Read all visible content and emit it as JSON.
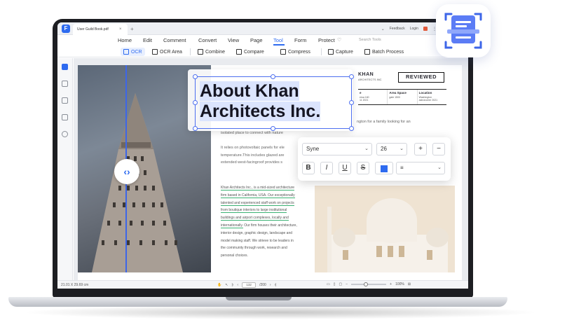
{
  "window": {
    "tab_title": "User Guild Book.pdf",
    "tab_close": "×",
    "tab_add": "+",
    "feedback": "Feedback",
    "login": "Login"
  },
  "menu": {
    "items": [
      "Home",
      "Edit",
      "Comment",
      "Convert",
      "View",
      "Page",
      "Tool",
      "Form",
      "Protect"
    ],
    "active": "Tool",
    "search_placeholder": "Search Tools"
  },
  "toolbar": {
    "tools": [
      "OCR",
      "OCR Area",
      "Combine",
      "Compare",
      "Compress",
      "Capture",
      "Batch Process"
    ],
    "active": "OCR"
  },
  "document": {
    "brand_name": "KHAN",
    "brand_sub": "ARCHITECTS INC",
    "badge": "REVIEWED",
    "info": [
      {
        "head": "e",
        "value": "ersa 160\n11 2021"
      },
      {
        "head": "Area Space",
        "value": "gate 1500"
      },
      {
        "head": "Location",
        "value": "Washington\nastronomer 2021"
      }
    ],
    "right_line": "ngton for a family looking for an",
    "body_lines": [
      "isolated place to connect with nature",
      "",
      "It relies on photovoltaic panels for ele",
      "temperature.This includes glazed are",
      "extended west-facingroof provides s"
    ],
    "paragraph_highlighted": [
      "Khan Architects Inc., is a mid-sized architecture",
      "firm based in California, USA. Our exceptionally",
      "talented and experienced staff work on projects",
      "from boutique interiors to large institutional",
      "buildings and airport complexes, locally and",
      "internationally."
    ],
    "paragraph_plain": [
      "Our firm houses their architecture,",
      "interior design, graphic design, landscape and",
      "model making staff. We strieve to be leaders in",
      "the community through work, research and",
      "personal choices."
    ]
  },
  "ocr_selection": {
    "line1": "About Khan",
    "line2": "Architects Inc."
  },
  "font_panel": {
    "font_family": "Syne",
    "font_size": "26",
    "increase": "+",
    "decrease": "−",
    "bold": "B",
    "italic": "I",
    "underline": "U",
    "strike": "S",
    "color": "#2e6bf0"
  },
  "statusbar": {
    "dimensions": "21.01 X 29.69 cm",
    "page_current": "132",
    "page_total": "/200",
    "zoom": "100%"
  },
  "colors": {
    "accent": "#2e6bf0",
    "highlight_underline": "#3bb273",
    "selection": "#4d6ff0"
  },
  "icons": {
    "compare_handle": "compare-arrows-icon",
    "app_icon": "ocr-scan-icon"
  }
}
